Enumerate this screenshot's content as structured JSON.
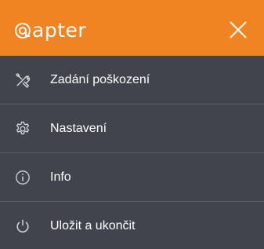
{
  "header": {
    "brand": "apter",
    "bg_color": "#f08322"
  },
  "menu": {
    "bg_color": "#41444d",
    "items": [
      {
        "label": "Zadání poškození",
        "icon": "tools-icon"
      },
      {
        "label": "Nastavení",
        "icon": "gear-icon"
      },
      {
        "label": "Info",
        "icon": "info-icon"
      },
      {
        "label": "Uložit a ukončit",
        "icon": "power-icon"
      }
    ]
  }
}
